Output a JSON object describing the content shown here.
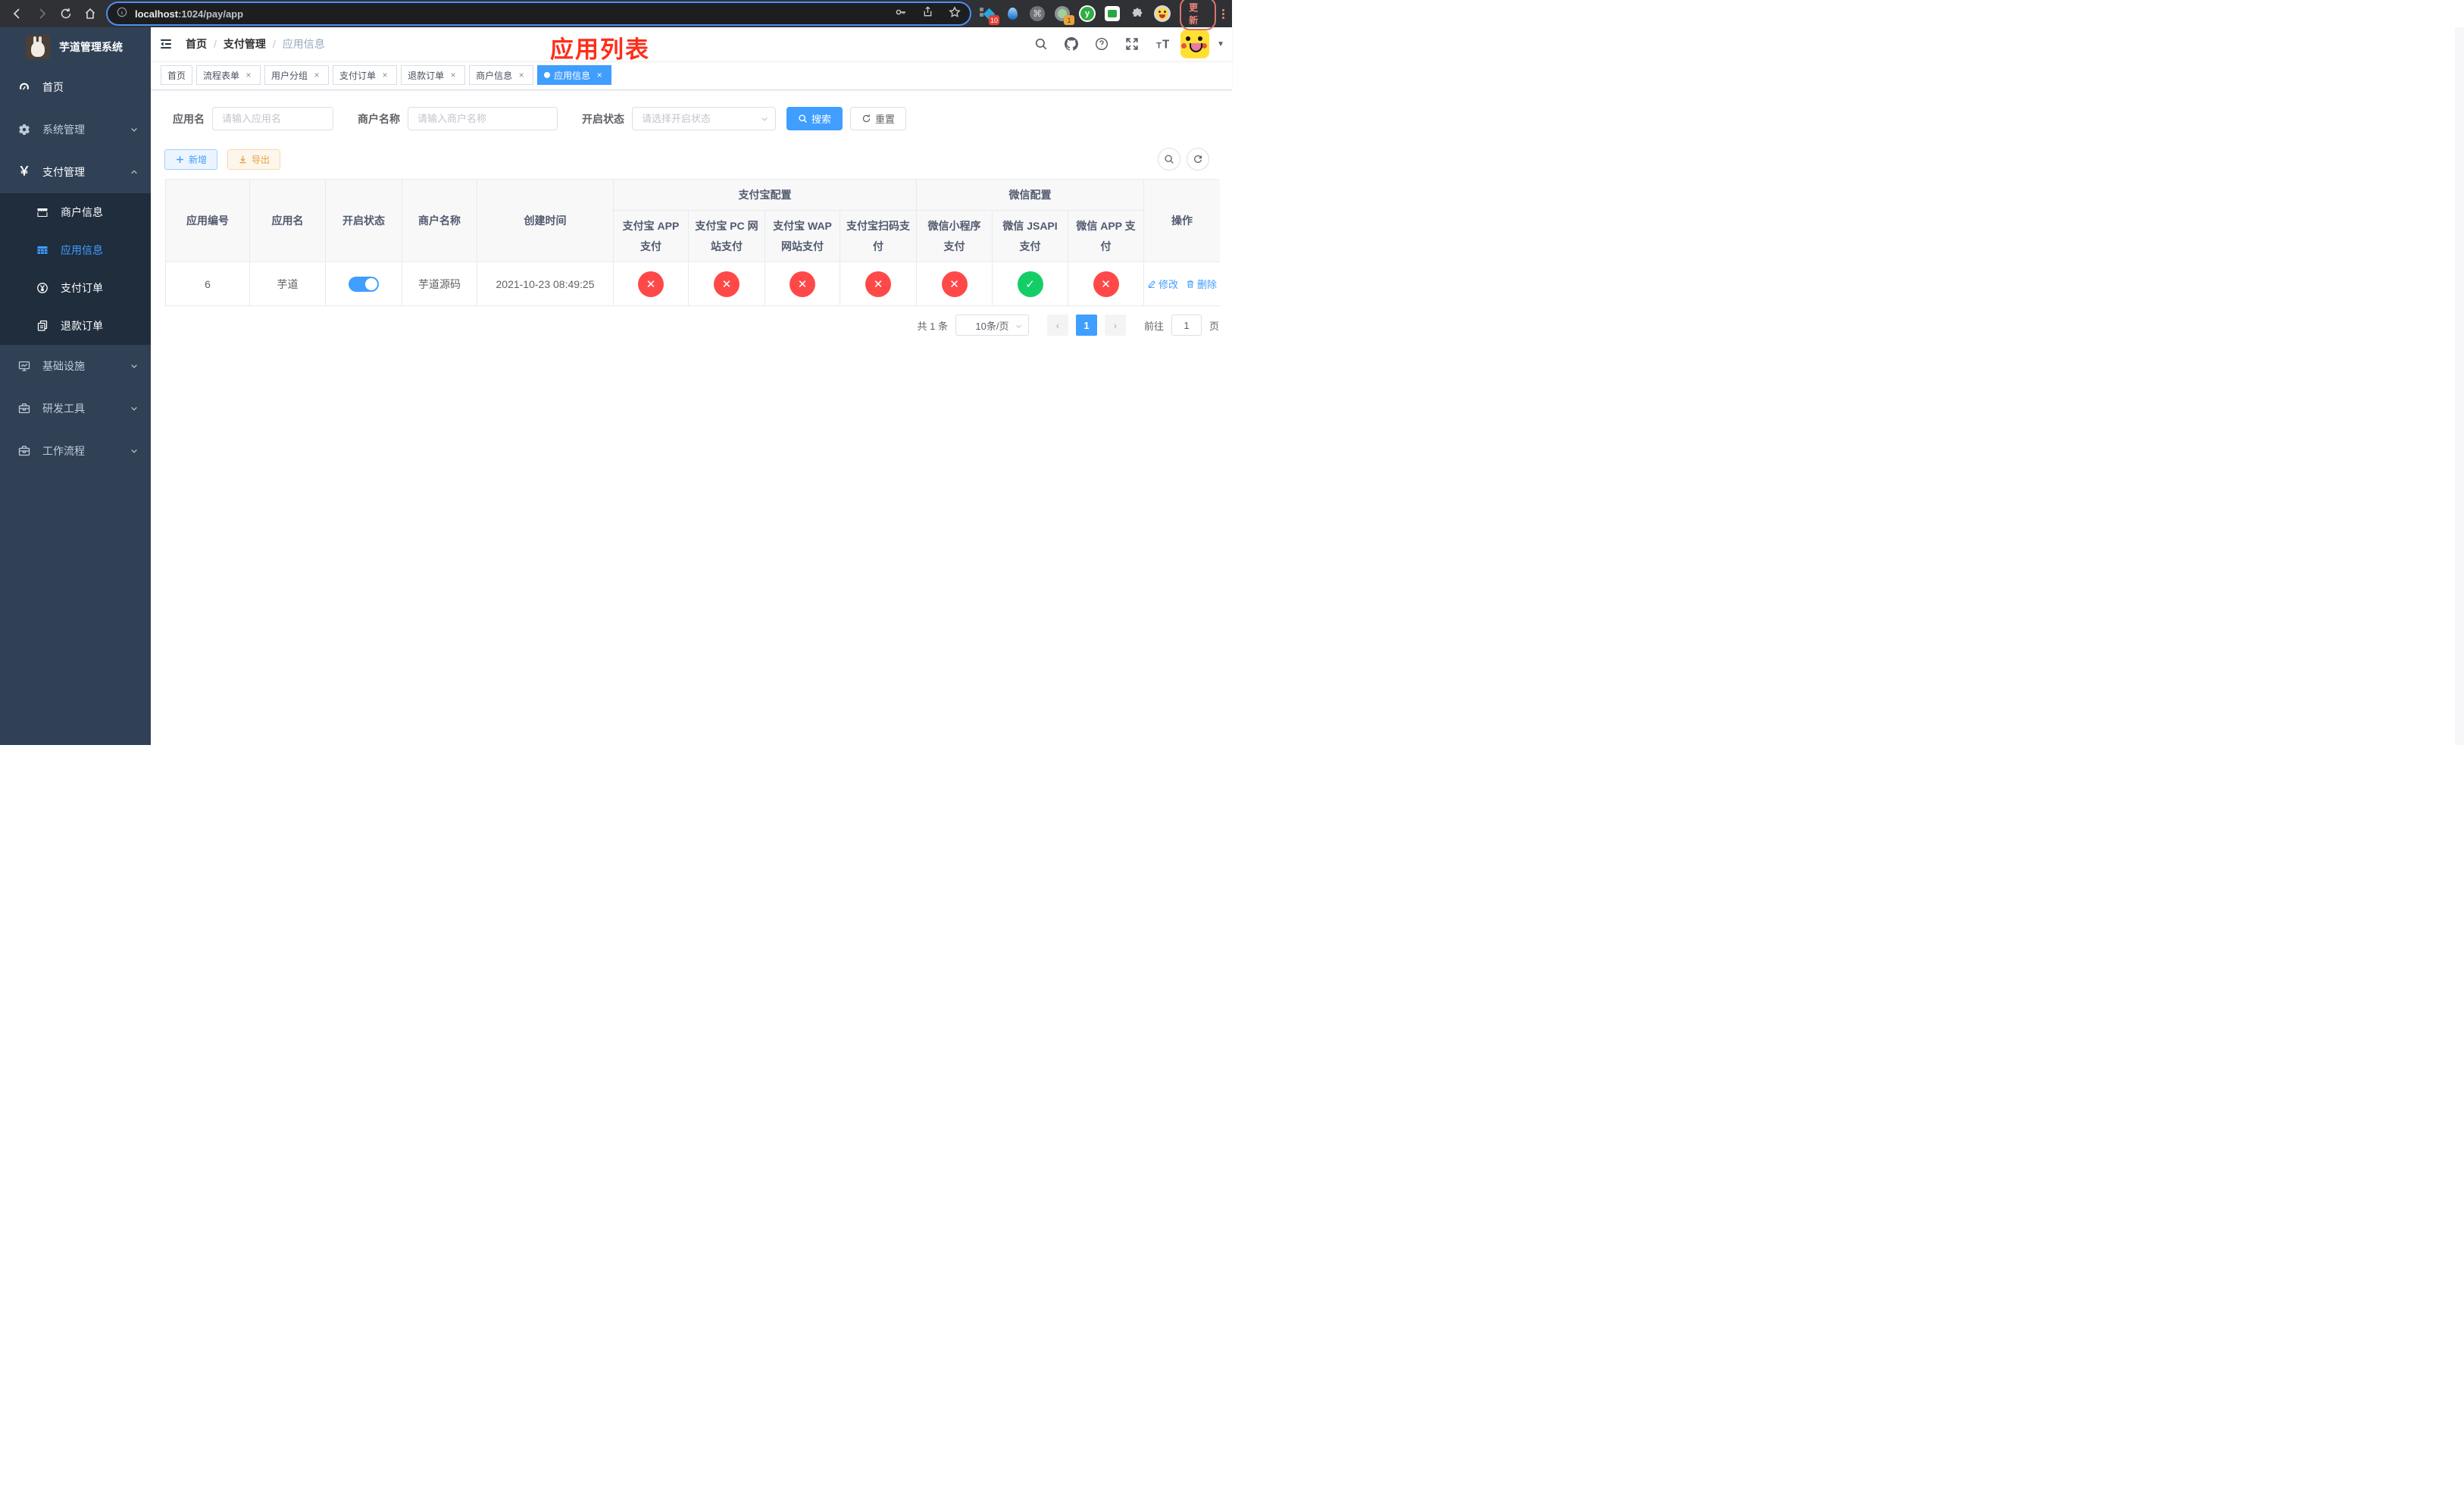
{
  "browser": {
    "url_host": "localhost",
    "url_rest": ":1024/pay/app",
    "ext_badge_blue_diamond": "10",
    "ext_badge_circle": "1",
    "ext_y_label": "y",
    "update_label": "更新"
  },
  "sidebar": {
    "title": "芋道管理系统",
    "items": [
      {
        "label": "首页"
      },
      {
        "label": "系统管理"
      },
      {
        "label": "支付管理"
      },
      {
        "label": "基础设施"
      },
      {
        "label": "研发工具"
      },
      {
        "label": "工作流程"
      }
    ],
    "submenu": [
      {
        "label": "商户信息"
      },
      {
        "label": "应用信息"
      },
      {
        "label": "支付订单"
      },
      {
        "label": "退款订单"
      }
    ]
  },
  "navbar": {
    "breadcrumb": [
      {
        "label": "首页"
      },
      {
        "label": "支付管理"
      },
      {
        "label": "应用信息"
      }
    ]
  },
  "annotation": {
    "title": "应用列表",
    "color": "#ff2d1a"
  },
  "tabs": [
    {
      "label": "首页"
    },
    {
      "label": "流程表单"
    },
    {
      "label": "用户分组"
    },
    {
      "label": "支付订单"
    },
    {
      "label": "退款订单"
    },
    {
      "label": "商户信息"
    },
    {
      "label": "应用信息"
    }
  ],
  "filters": {
    "app_name_label": "应用名",
    "app_name_placeholder": "请输入应用名",
    "merchant_label": "商户名称",
    "merchant_placeholder": "请输入商户名称",
    "status_label": "开启状态",
    "status_placeholder": "请选择开启状态",
    "search_label": "搜索",
    "reset_label": "重置"
  },
  "toolbar": {
    "add_label": "新增",
    "export_label": "导出"
  },
  "table": {
    "headers": {
      "app_id": "应用编号",
      "app_name": "应用名",
      "status": "开启状态",
      "merchant": "商户名称",
      "created": "创建时间",
      "alipay_group": "支付宝配置",
      "wechat_group": "微信配置",
      "operation": "操作",
      "alipay_app": "支付宝 APP 支付",
      "alipay_pc": "支付宝 PC 网站支付",
      "alipay_wap": "支付宝 WAP 网站支付",
      "alipay_qr": "支付宝扫码支付",
      "wechat_lite": "微信小程序支付",
      "wechat_jsapi": "微信 JSAPI 支付",
      "wechat_app": "微信 APP 支付"
    },
    "row": {
      "app_id": "6",
      "app_name": "芋道",
      "status_on": true,
      "merchant": "芋道源码",
      "created": "2021-10-23 08:49:25",
      "statuses": [
        false,
        false,
        false,
        false,
        false,
        true,
        false
      ],
      "edit_label": "修改",
      "delete_label": "删除"
    }
  },
  "pagination": {
    "total": "共 1 条",
    "page_size": "10条/页",
    "page": "1",
    "goto_label": "前往",
    "goto_value": "1",
    "page_unit": "页"
  }
}
